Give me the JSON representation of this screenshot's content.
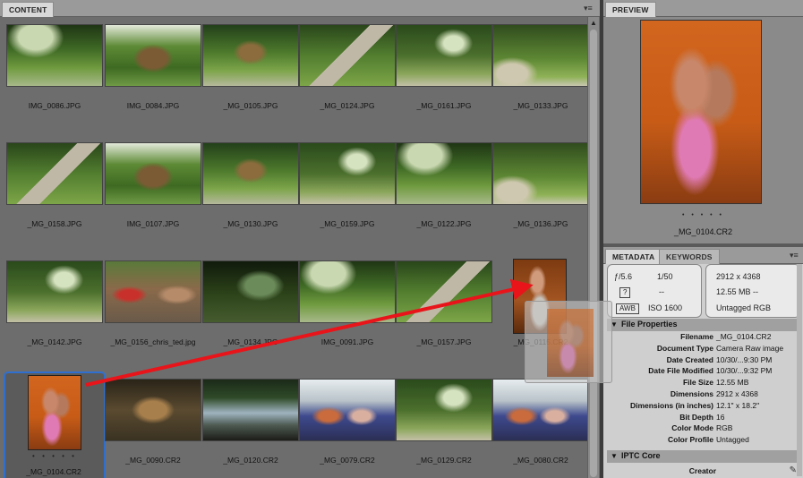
{
  "content_panel": {
    "tab_label": "CONTENT",
    "menu_icon": "panel-menu-icon",
    "items": [
      {
        "file": "IMG_0086.JPG",
        "photo": "ph-garden-a"
      },
      {
        "file": "IMG_0084.JPG",
        "photo": "ph-hut"
      },
      {
        "file": "_MG_0105.JPG",
        "photo": "ph-garden-b"
      },
      {
        "file": "_MG_0124.JPG",
        "photo": "ph-path"
      },
      {
        "file": "_MG_0161.JPG",
        "photo": "ph-garden-c"
      },
      {
        "file": "_MG_0133.JPG",
        "photo": "ph-garden-d"
      },
      {
        "file": "_MG_0158.JPG",
        "photo": "ph-path"
      },
      {
        "file": "IMG_0107.JPG",
        "photo": "ph-hut"
      },
      {
        "file": "_MG_0130.JPG",
        "photo": "ph-garden-b"
      },
      {
        "file": "_MG_0159.JPG",
        "photo": "ph-garden-c"
      },
      {
        "file": "_MG_0122.JPG",
        "photo": "ph-garden-a"
      },
      {
        "file": "_MG_0136.JPG",
        "photo": "ph-garden-d"
      },
      {
        "file": "_MG_0142.JPG",
        "photo": "ph-garden-c"
      },
      {
        "file": "_MG_0156_chris_ted.jpg",
        "photo": "ph-people"
      },
      {
        "file": "_MG_0134.JPG",
        "photo": "ph-dark"
      },
      {
        "file": "IMG_0091.JPG",
        "photo": "ph-garden-a"
      },
      {
        "file": "_MG_0157.JPG",
        "photo": "ph-path"
      },
      {
        "file": "_MG_0115.CR2",
        "photo": "ph-portrait2",
        "portrait": true
      },
      {
        "file": "_MG_0104.CR2",
        "photo": "ph-portrait",
        "portrait": true,
        "selected": true,
        "rating": "• • • • •"
      },
      {
        "file": "_MG_0090.CR2",
        "photo": "ph-porch"
      },
      {
        "file": "_MG_0120.CR2",
        "photo": "ph-water"
      },
      {
        "file": "_MG_0079.CR2",
        "photo": "ph-boat"
      },
      {
        "file": "_MG_0129.CR2",
        "photo": "ph-garden-c"
      },
      {
        "file": "_MG_0080.CR2",
        "photo": "ph-boat"
      }
    ]
  },
  "preview_panel": {
    "tab_label": "PREVIEW",
    "rating": "• • • • •",
    "filename": "_MG_0104.CR2"
  },
  "metadata_panel": {
    "tabs": [
      "METADATA",
      "KEYWORDS"
    ],
    "summary": {
      "aperture": "ƒ/5.6",
      "shutter": "1/50",
      "flash_glyph": "?",
      "flash_value": "--",
      "wb_glyph": "AWB",
      "iso": "ISO 1600",
      "pixel_dims": "2912 x 4368",
      "size_line": "12.55 MB  --",
      "color": "Untagged  RGB"
    },
    "file_properties_title": "File Properties",
    "rows": [
      {
        "key": "Filename",
        "value": "_MG_0104.CR2"
      },
      {
        "key": "Document Type",
        "value": "Camera Raw image"
      },
      {
        "key": "Date Created",
        "value": "10/30/...9:30 PM"
      },
      {
        "key": "Date File Modified",
        "value": "10/30/...9:32 PM"
      },
      {
        "key": "File Size",
        "value": "12.55 MB"
      },
      {
        "key": "Dimensions",
        "value": "2912 x 4368"
      },
      {
        "key": "Dimensions (in inches)",
        "value": "12.1\" x 18.2\""
      },
      {
        "key": "Bit Depth",
        "value": "16"
      },
      {
        "key": "Color Mode",
        "value": "RGB"
      },
      {
        "key": "Color Profile",
        "value": "Untagged"
      }
    ],
    "iptc_title": "IPTC Core",
    "creator_label": "Creator"
  },
  "colors": {
    "selection": "#2f6fd0",
    "arrow": "#e8141a",
    "panel_bg": "#6d6d6d"
  }
}
